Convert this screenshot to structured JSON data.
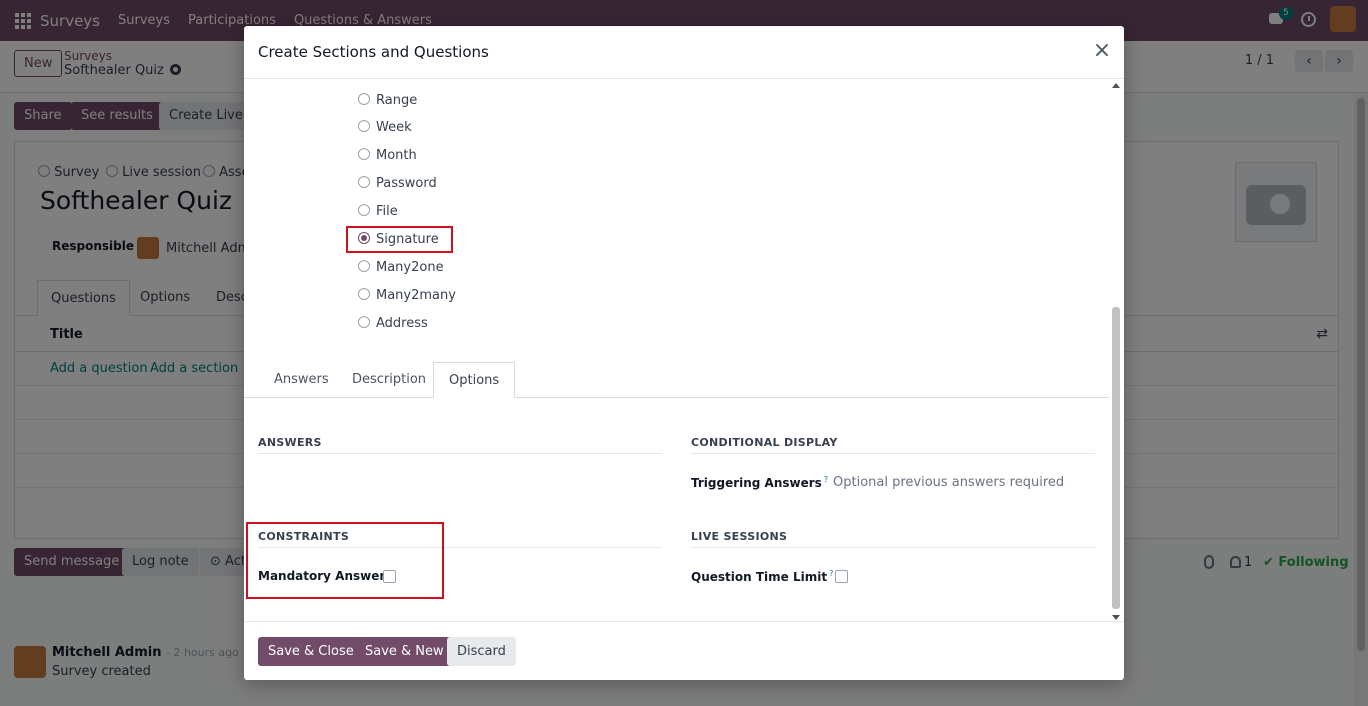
{
  "navbar": {
    "brand": "Surveys",
    "menu": [
      "Surveys",
      "Participations",
      "Questions & Answers"
    ],
    "chat_badge": "5"
  },
  "control": {
    "new_label": "New",
    "breadcrumb_parent": "Surveys",
    "breadcrumb_current": "Softhealer Quiz",
    "pager": "1 / 1"
  },
  "actions": {
    "share": "Share",
    "see_results": "See results",
    "create_live": "Create Live S"
  },
  "form": {
    "type_options": [
      "Survey",
      "Live session",
      "Asse"
    ],
    "title": "Softhealer Quiz",
    "responsible_label": "Responsible",
    "responsible_name": "Mitchell Admi",
    "tabs": [
      "Questions",
      "Options",
      "Desc"
    ],
    "list_header": "Title",
    "add_question": "Add a question",
    "add_section": "Add a section"
  },
  "chatter": {
    "send_message": "Send message",
    "log_note": "Log note",
    "activities": "Act",
    "follower_count": "1",
    "following": "Following",
    "message_author": "Mitchell Admin",
    "message_time": "- 2 hours ago",
    "message_body": "Survey created"
  },
  "modal": {
    "title": "Create Sections and Questions",
    "question_types": [
      {
        "label": "Range",
        "checked": false
      },
      {
        "label": "Week",
        "checked": false
      },
      {
        "label": "Month",
        "checked": false
      },
      {
        "label": "Password",
        "checked": false
      },
      {
        "label": "File",
        "checked": false
      },
      {
        "label": "Signature",
        "checked": true
      },
      {
        "label": "Many2one",
        "checked": false
      },
      {
        "label": "Many2many",
        "checked": false
      },
      {
        "label": "Address",
        "checked": false
      }
    ],
    "tabs": [
      "Answers",
      "Description",
      "Options"
    ],
    "active_tab": "Options",
    "sections": {
      "answers": "ANSWERS",
      "conditional_display": "CONDITIONAL DISPLAY",
      "constraints": "CONSTRAINTS",
      "live_sessions": "LIVE SESSIONS"
    },
    "fields": {
      "triggering_answers_label": "Triggering Answers",
      "triggering_answers_placeholder": "Optional previous answers required",
      "mandatory_answer_label": "Mandatory Answer",
      "question_time_limit_label": "Question Time Limit",
      "help_mark": "?"
    },
    "footer": {
      "save_close": "Save & Close",
      "save_new": "Save & New",
      "discard": "Discard"
    }
  },
  "colors": {
    "brand": "#714b67",
    "highlight": "#d0101e",
    "following": "#28a745"
  }
}
